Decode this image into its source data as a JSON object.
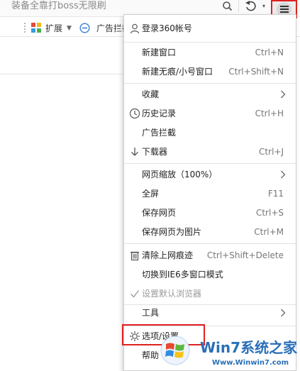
{
  "search": {
    "text": "装备全靠打boss无限刷"
  },
  "toolbar": {
    "extensions_label": "扩展",
    "adblock_label": "广告拦截"
  },
  "menu": {
    "login": "登录360帐号",
    "new_window": {
      "label": "新建窗口",
      "shortcut": "Ctrl+N"
    },
    "new_incognito": {
      "label": "新建无痕/小号窗口",
      "shortcut": "Ctrl+Shift+N"
    },
    "favorites": {
      "label": "收藏"
    },
    "history": {
      "label": "历史记录",
      "shortcut": "Ctrl+H"
    },
    "adblock": {
      "label": "广告拦截"
    },
    "downloader": {
      "label": "下载器",
      "shortcut": "Ctrl+J"
    },
    "zoom": {
      "label": "网页缩放（100%）"
    },
    "fullscreen": {
      "label": "全屏",
      "shortcut": "F11"
    },
    "save_page": {
      "label": "保存网页",
      "shortcut": "Ctrl+S"
    },
    "save_as_image": {
      "label": "保存网页为图片",
      "shortcut": "Ctrl+M"
    },
    "clear_traces": {
      "label": "清除上网痕迹",
      "shortcut": "Ctrl+Shift+Delete"
    },
    "ie6_mode": {
      "label": "切换到IE6多窗口模式"
    },
    "set_default": {
      "label": "设置默认浏览器"
    },
    "tools": {
      "label": "工具"
    },
    "options": {
      "label": "选项/设置"
    },
    "help": {
      "label": "帮助"
    }
  },
  "watermark": {
    "title": "Win7系统之家",
    "url": "Www.Winwin7.com"
  },
  "colors": {
    "highlight": "#e02020",
    "watermark_blue": "#2a6fb8"
  }
}
